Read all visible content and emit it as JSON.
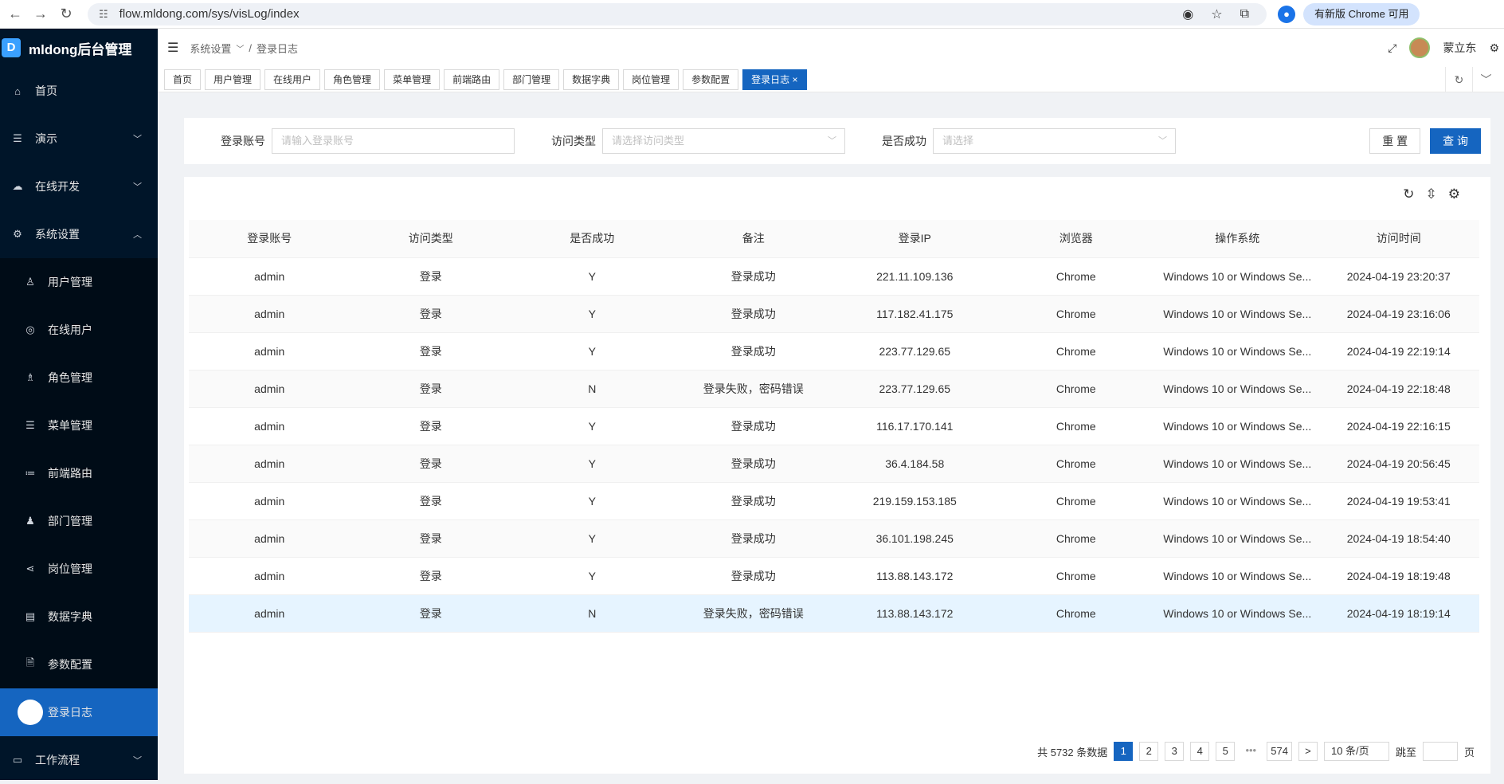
{
  "browser": {
    "url": "flow.mldong.com/sys/visLog/index",
    "update_label": "有新版 Chrome 可用"
  },
  "brand": {
    "name": "mldong后台管理",
    "logo": "D"
  },
  "sidebar": {
    "items": [
      {
        "label": "首页",
        "icon": "⌂"
      },
      {
        "label": "演示",
        "icon": "☰"
      },
      {
        "label": "在线开发",
        "icon": "☁"
      },
      {
        "label": "系统设置",
        "icon": "⚙"
      },
      {
        "label": "工作流程",
        "icon": "▭"
      }
    ],
    "subitems": [
      {
        "label": "用户管理",
        "icon": "♙"
      },
      {
        "label": "在线用户",
        "icon": "◎"
      },
      {
        "label": "角色管理",
        "icon": "♗"
      },
      {
        "label": "菜单管理",
        "icon": "☰"
      },
      {
        "label": "前端路由",
        "icon": "≔"
      },
      {
        "label": "部门管理",
        "icon": "♟"
      },
      {
        "label": "岗位管理",
        "icon": "⋖"
      },
      {
        "label": "数据字典",
        "icon": "▤"
      },
      {
        "label": "参数配置",
        "icon": "🗎"
      },
      {
        "label": "登录日志",
        "icon": ""
      }
    ]
  },
  "header": {
    "breadcrumb": [
      "系统设置",
      "登录日志"
    ],
    "separator": "/",
    "user": "蒙立东"
  },
  "tabs": [
    "首页",
    "用户管理",
    "在线用户",
    "角色管理",
    "菜单管理",
    "前端路由",
    "部门管理",
    "数据字典",
    "岗位管理",
    "参数配置",
    "登录日志 ×"
  ],
  "search": {
    "account_label": "登录账号",
    "account_placeholder": "请输入登录账号",
    "type_label": "访问类型",
    "type_placeholder": "请选择访问类型",
    "success_label": "是否成功",
    "success_placeholder": "请选择",
    "reset": "重 置",
    "query": "查 询"
  },
  "table": {
    "columns": [
      "登录账号",
      "访问类型",
      "是否成功",
      "备注",
      "登录IP",
      "浏览器",
      "操作系统",
      "访问时间"
    ],
    "rows": [
      [
        "admin",
        "登录",
        "Y",
        "登录成功",
        "221.11.109.136",
        "Chrome",
        "Windows 10 or Windows Se...",
        "2024-04-19 23:20:37"
      ],
      [
        "admin",
        "登录",
        "Y",
        "登录成功",
        "117.182.41.175",
        "Chrome",
        "Windows 10 or Windows Se...",
        "2024-04-19 23:16:06"
      ],
      [
        "admin",
        "登录",
        "Y",
        "登录成功",
        "223.77.129.65",
        "Chrome",
        "Windows 10 or Windows Se...",
        "2024-04-19 22:19:14"
      ],
      [
        "admin",
        "登录",
        "N",
        "登录失败，密码错误",
        "223.77.129.65",
        "Chrome",
        "Windows 10 or Windows Se...",
        "2024-04-19 22:18:48"
      ],
      [
        "admin",
        "登录",
        "Y",
        "登录成功",
        "116.17.170.141",
        "Chrome",
        "Windows 10 or Windows Se...",
        "2024-04-19 22:16:15"
      ],
      [
        "admin",
        "登录",
        "Y",
        "登录成功",
        "36.4.184.58",
        "Chrome",
        "Windows 10 or Windows Se...",
        "2024-04-19 20:56:45"
      ],
      [
        "admin",
        "登录",
        "Y",
        "登录成功",
        "219.159.153.185",
        "Chrome",
        "Windows 10 or Windows Se...",
        "2024-04-19 19:53:41"
      ],
      [
        "admin",
        "登录",
        "Y",
        "登录成功",
        "36.101.198.245",
        "Chrome",
        "Windows 10 or Windows Se...",
        "2024-04-19 18:54:40"
      ],
      [
        "admin",
        "登录",
        "Y",
        "登录成功",
        "113.88.143.172",
        "Chrome",
        "Windows 10 or Windows Se...",
        "2024-04-19 18:19:48"
      ],
      [
        "admin",
        "登录",
        "N",
        "登录失败，密码错误",
        "113.88.143.172",
        "Chrome",
        "Windows 10 or Windows Se...",
        "2024-04-19 18:19:14"
      ]
    ]
  },
  "pagination": {
    "total": "共 5732 条数据",
    "pages": [
      "1",
      "2",
      "3",
      "4",
      "5"
    ],
    "ellipsis": "•••",
    "last": "574",
    "next": ">",
    "page_size": "10 条/页",
    "goto": "跳至",
    "page_unit": "页"
  }
}
